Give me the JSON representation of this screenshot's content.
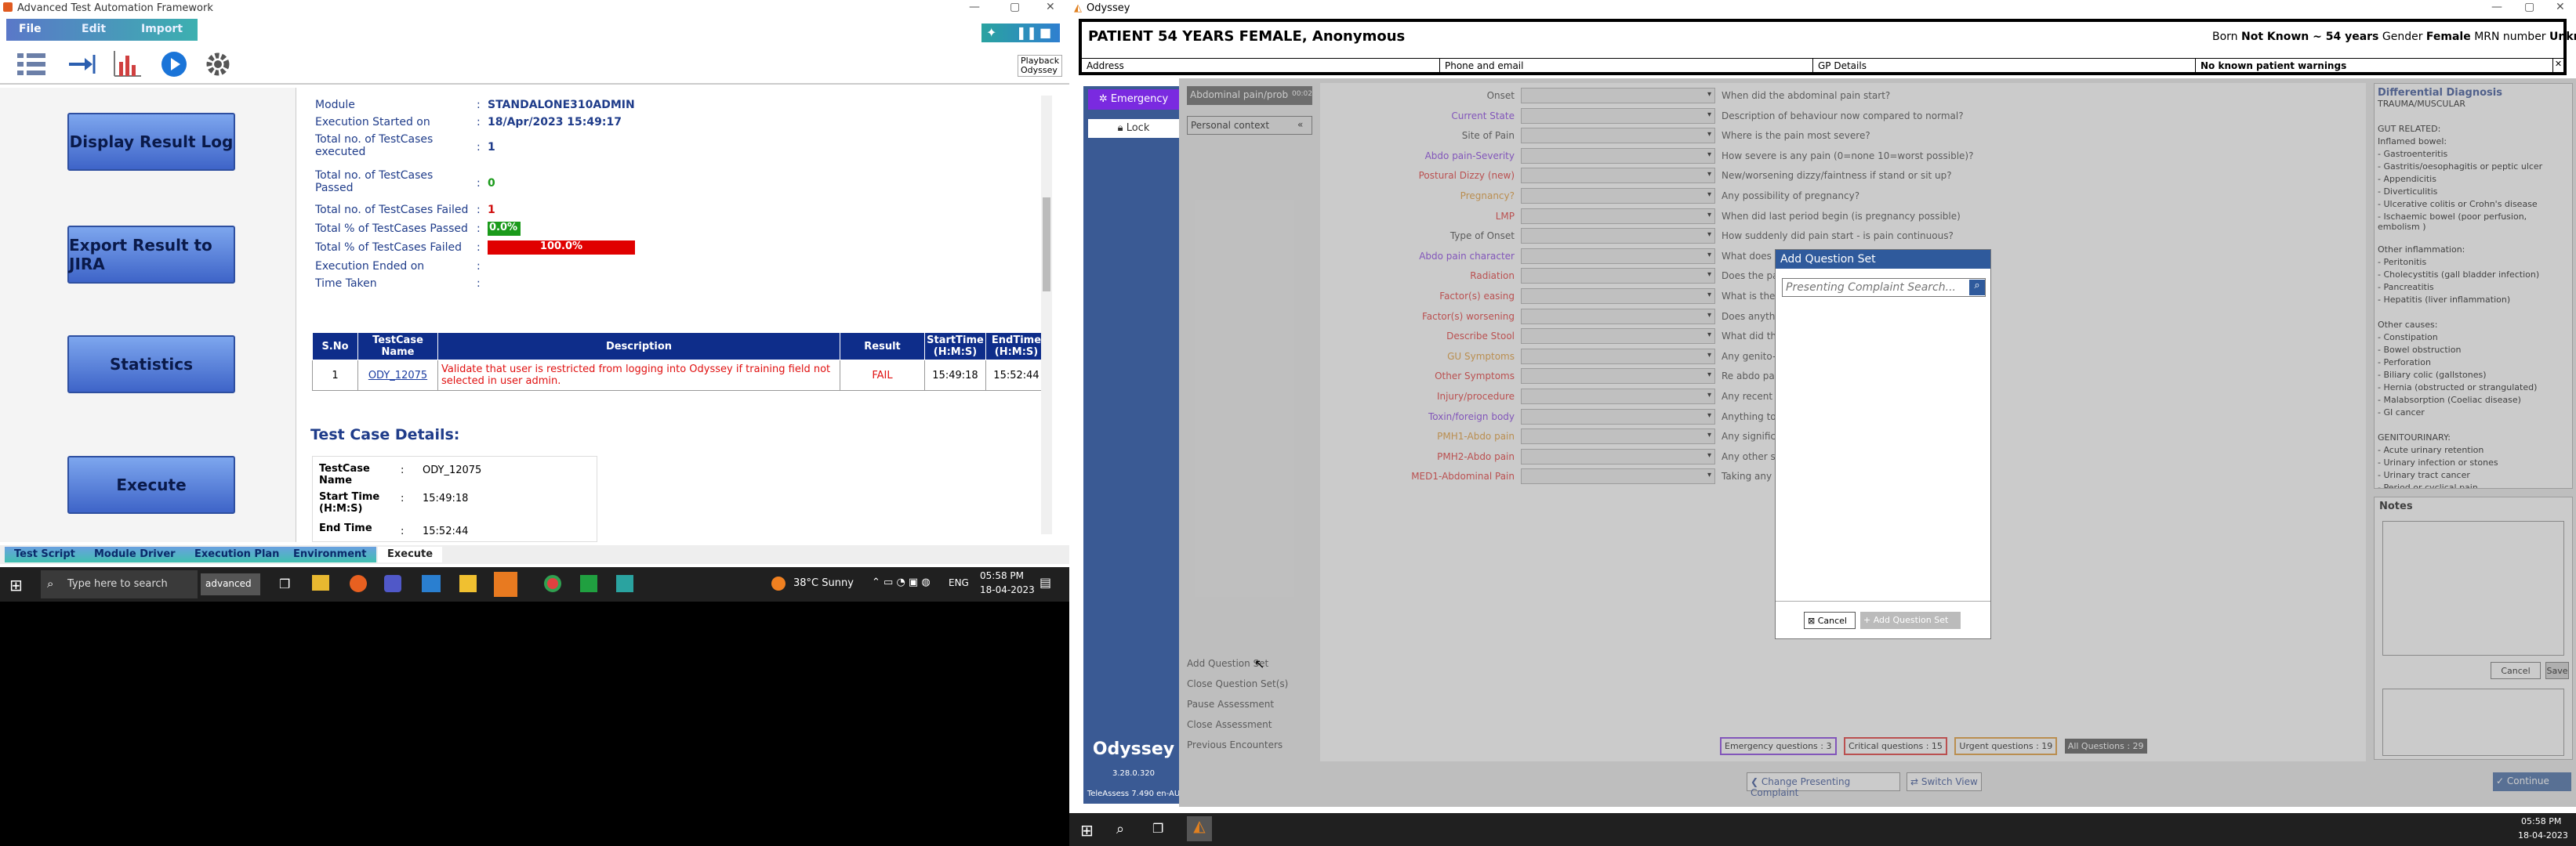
{
  "left_window": {
    "title": "Advanced Test Automation Framework",
    "menu": {
      "file": "File",
      "edit": "Edit",
      "import": "Import"
    },
    "playback": {
      "line1": "Playback",
      "line2": "Odyssey"
    },
    "side_buttons": [
      "Display Result Log",
      "Export Result to JIRA",
      "Statistics",
      "Execute"
    ],
    "summary": {
      "module_label": "Module",
      "module_value": "STANDALONE310ADMIN",
      "exec_started_label": "Execution Started on",
      "exec_started_value": "18/Apr/2023 15:49:17",
      "total_executed_label": "Total no. of TestCases executed",
      "total_executed_value": "1",
      "total_passed_label": "Total no. of TestCases Passed",
      "total_passed_value": "0",
      "total_failed_label": "Total no. of TestCases Failed",
      "total_failed_value": "1",
      "pct_passed_label": "Total % of TestCases Passed",
      "pct_passed_value": "0.0%",
      "pct_failed_label": "Total % of TestCases Failed",
      "pct_failed_value": "100.0%",
      "exec_ended_label": "Execution Ended on",
      "time_taken_label": "Time Taken",
      "sep": ":"
    },
    "results_table": {
      "headers": [
        "S.No",
        "TestCase Name",
        "Description",
        "Result",
        "StartTime (H:M:S)",
        "EndTime (H:M:S)"
      ],
      "rows": [
        [
          "1",
          "ODY_12075",
          "Validate that user is restricted from logging into Odyssey if training field not selected in user admin.",
          "FAIL",
          "15:49:18",
          "15:52:44"
        ]
      ]
    },
    "details_heading": "Test Case Details:",
    "details": {
      "name_label": "TestCase Name",
      "name_value": "ODY_12075",
      "start_label": "Start Time (H:M:S)",
      "start_value": "15:49:18",
      "end_label": "End Time",
      "end_value": "15:52:44"
    },
    "tabs": [
      "Test Script",
      "Module Driver",
      "Execution Plan",
      "Environment",
      "Execute"
    ],
    "taskbar": {
      "search": "Type here to search",
      "weather": "38°C  Sunny",
      "lang": "ENG",
      "time": "05:58 PM",
      "date": "18-04-2023",
      "app": "advanced"
    }
  },
  "right_window": {
    "title": "Odyssey",
    "patient": {
      "name": "PATIENT 54 YEARS FEMALE, Anonymous",
      "born_label": "Born",
      "born_value": "Not Known ~ 54 years",
      "gender_label": "Gender",
      "gender_value": "Female",
      "mrn_label": "MRN number",
      "mrn_value": "Unknown"
    },
    "info": {
      "address": "Address",
      "phone": "Phone and email",
      "gp": "GP Details",
      "warnings": "No known patient warnings"
    },
    "nav": {
      "emergency": "Emergency",
      "lock": "Lock",
      "brand": "Odyssey",
      "version": "3.28.0.320",
      "teleassess": "TeleAssess 7.490 en-AU"
    },
    "tabs": {
      "complaint": "Abdominal pain/prob",
      "complaint_badge": "00:02",
      "context": "Personal context"
    },
    "questions": [
      {
        "label": "Onset",
        "text": "When did the abdominal pain start?"
      },
      {
        "label": "Current State",
        "text": "Description of behaviour now compared to normal?"
      },
      {
        "label": "Site of Pain",
        "text": "Where is the pain most severe?"
      },
      {
        "label": "Abdo pain-Severity",
        "text": "How severe is any pain (0=none 10=worst possible)?"
      },
      {
        "label": "Postural Dizzy (new)",
        "text": "New/worsening dizzy/faintness if stand or sit up?"
      },
      {
        "label": "Pregnancy?",
        "text": "Any possibility of pregnancy?"
      },
      {
        "label": "LMP",
        "text": "When did last period begin (is pregnancy possible)"
      },
      {
        "label": "Type of Onset",
        "text": "How suddenly did pain start - is pain continuous?"
      },
      {
        "label": "Abdo pain character",
        "text": "What does o"
      },
      {
        "label": "Radiation",
        "text": "Does the pain"
      },
      {
        "label": "Factor(s) easing",
        "text": "What is the m"
      },
      {
        "label": "Factor(s) worsening",
        "text": "Does anything"
      },
      {
        "label": "Describe Stool",
        "text": "What did the"
      },
      {
        "label": "GU Symptoms",
        "text": "Any genito-ur"
      },
      {
        "label": "Other Symptoms",
        "text": "Re abdo pain,"
      },
      {
        "label": "Injury/procedure",
        "text": "Any recent ab"
      },
      {
        "label": "Toxin/foreign body",
        "text": "Anything toxi"
      },
      {
        "label": "PMH1-Abdo pain",
        "text": "Any significan"
      },
      {
        "label": "PMH2-Abdo pain",
        "text": "Any other sig"
      },
      {
        "label": "MED1-Abdominal Pain",
        "text": "Taking any m"
      }
    ],
    "actions": [
      "Add Question Set",
      "Close Question Set(s)",
      "Pause Assessment",
      "Close Assessment",
      "Previous Encounters"
    ],
    "diff": {
      "title": "Differential Diagnosis",
      "lines": [
        "TRAUMA/MUSCULAR",
        "",
        "GUT RELATED:",
        "Inflamed bowel:",
        "- Gastroenteritis",
        "- Gastritis/oesophagitis or peptic ulcer",
        "- Appendicitis",
        "- Diverticulitis",
        "- Ulcerative colitis or Crohn's disease",
        "- Ischaemic bowel (poor perfusion, embolism )",
        "",
        "Other inflammation:",
        "- Peritonitis",
        "- Cholecystitis (gall bladder infection)",
        "- Pancreatitis",
        "- Hepatitis (liver inflammation)",
        "",
        "Other causes:",
        "- Constipation",
        "- Bowel obstruction",
        "- Perforation",
        "- Biliary colic (gallstones)",
        "- Hernia (obstructed or strangulated)",
        "- Malabsorption (Coeliac disease)",
        "- GI cancer",
        "",
        "GENITOURINARY:",
        "- Acute urinary retention",
        "- Urinary infection or stones",
        "- Urinary tract cancer",
        "- Period or cyclical pain"
      ]
    },
    "notes": {
      "title": "Notes",
      "cancel": "Cancel",
      "save": "Save"
    },
    "counters": [
      "Emergency questions : 3",
      "Critical questions : 15",
      "Urgent questions : 19",
      "All Questions : 29"
    ],
    "bottom": {
      "change": "Change Presenting Complaint",
      "switch": "Switch View",
      "continue": "Continue"
    },
    "modal": {
      "title": "Add Question Set",
      "placeholder": "Presenting Complaint Search...",
      "cancel": "Cancel",
      "add": "Add Question Set"
    },
    "taskbar": {
      "time": "05:58 PM",
      "date": "18-04-2023"
    }
  }
}
